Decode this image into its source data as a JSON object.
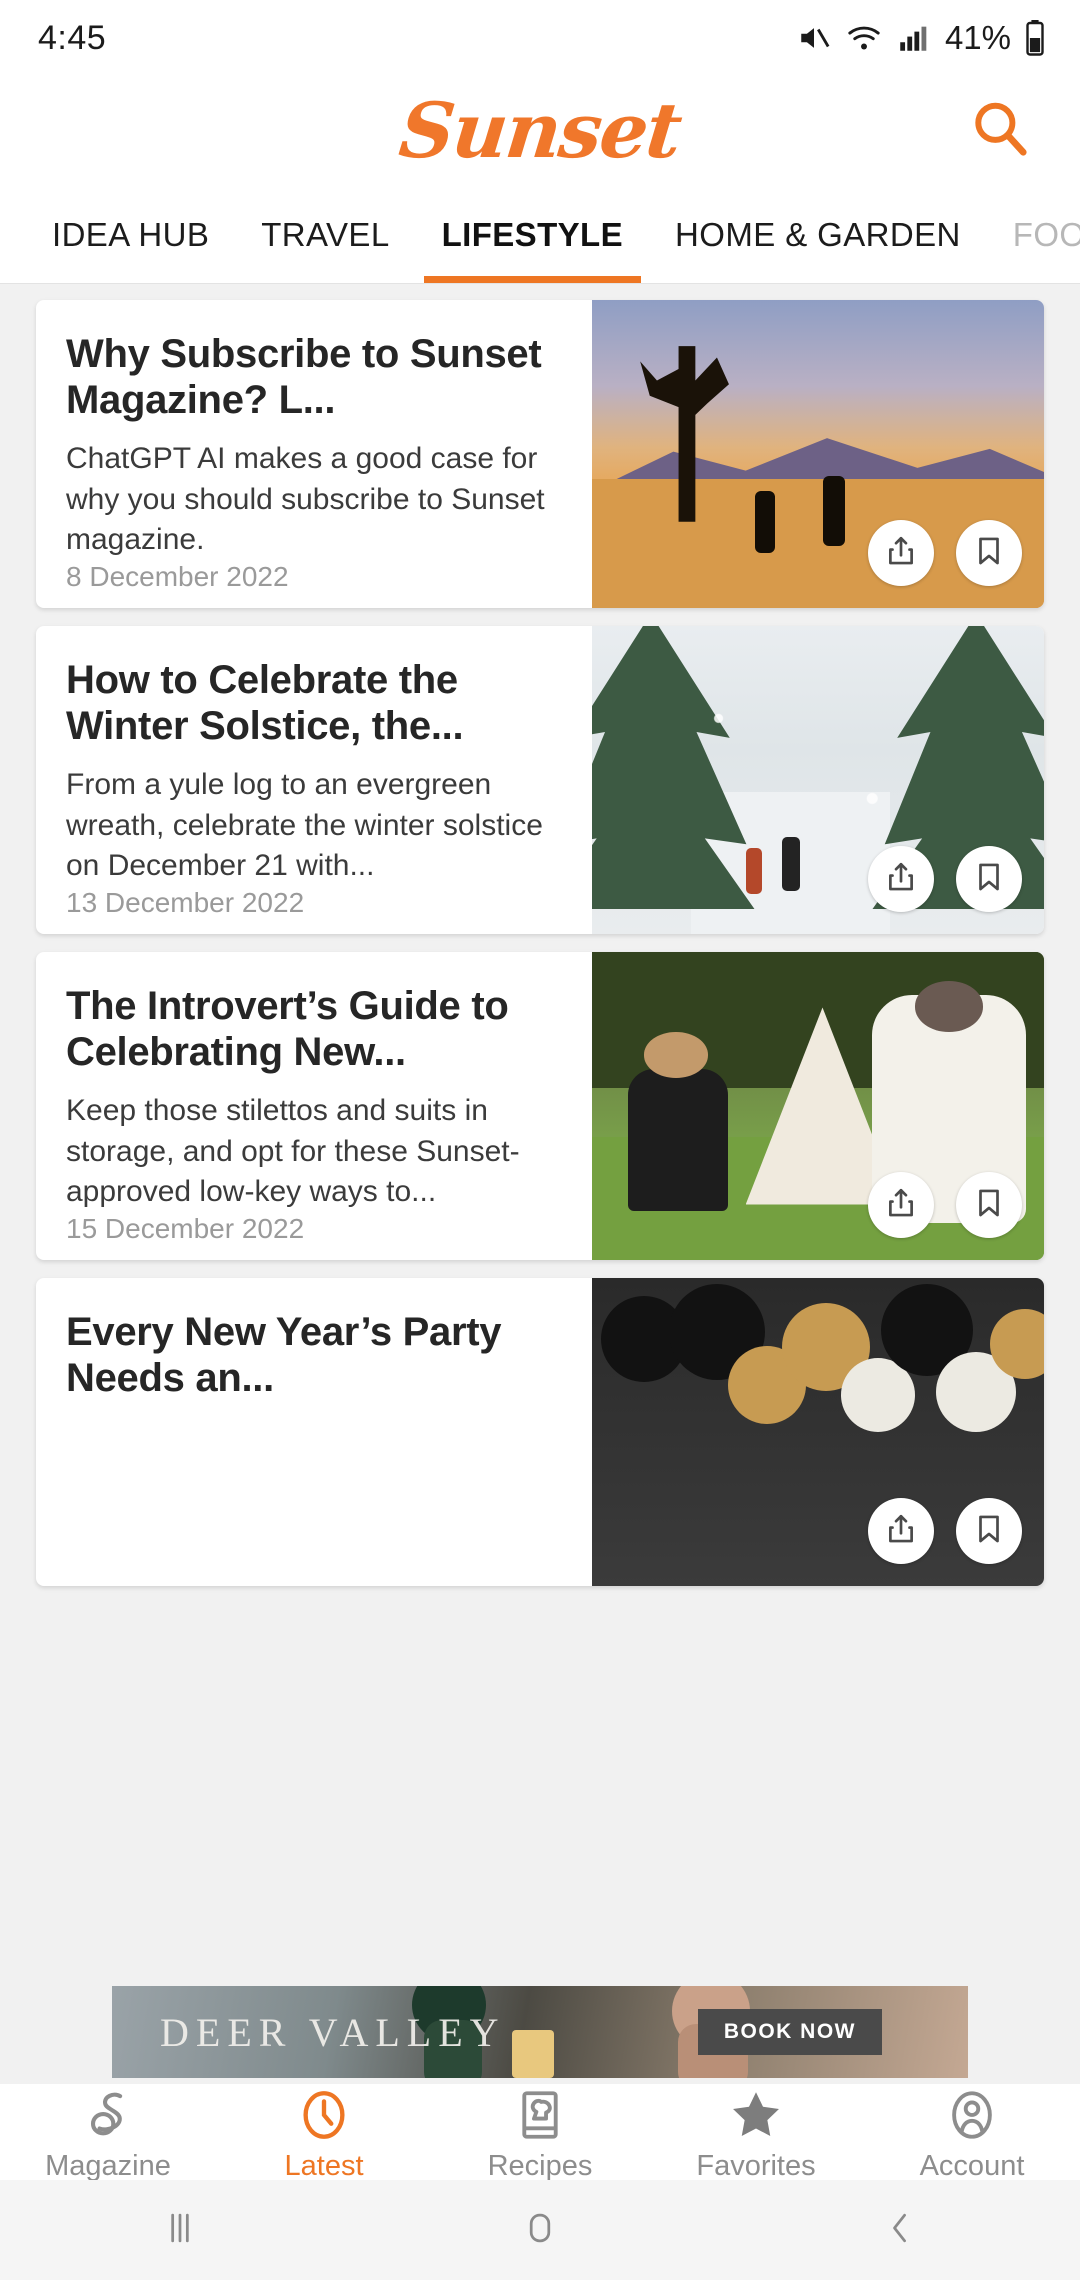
{
  "status_bar": {
    "time": "4:45",
    "battery_percent": "41%",
    "icons": [
      "mute-icon",
      "wifi-icon",
      "signal-icon",
      "battery-icon"
    ]
  },
  "header": {
    "logo_text": "Sunset",
    "search_icon": "search-icon",
    "brand_color": "#ee7623"
  },
  "category_tabs": [
    {
      "label": "IDEA HUB",
      "active": false
    },
    {
      "label": "TRAVEL",
      "active": false
    },
    {
      "label": "LIFESTYLE",
      "active": true
    },
    {
      "label": "HOME & GARDEN",
      "active": false
    },
    {
      "label": "FOOD",
      "active": false,
      "clipped": true
    }
  ],
  "feed": {
    "articles": [
      {
        "title": "Why Subscribe to Sunset Magazine? L...",
        "description": "ChatGPT AI makes a good case for why you should subscribe to Sunset magazine.",
        "date": "8 December 2022",
        "image_alt": "joshua-tree-desert-sunset-photo",
        "share_icon": "share-icon",
        "bookmark_icon": "bookmark-icon"
      },
      {
        "title": "How to Celebrate the Winter Solstice, the...",
        "description": "From a yule log to an evergreen wreath, celebrate the winter solstice on December 21 with...",
        "date": "13 December 2022",
        "image_alt": "snowy-evergreen-forest-path-photo",
        "share_icon": "share-icon",
        "bookmark_icon": "bookmark-icon"
      },
      {
        "title": "The Introvert’s Guide to Celebrating New...",
        "description": "Keep those stilettos and suits in storage, and opt for these Sunset-approved low-key ways to...",
        "date": "15 December 2022",
        "image_alt": "backyard-tent-gathering-photo",
        "share_icon": "share-icon",
        "bookmark_icon": "bookmark-icon"
      },
      {
        "title": "Every New Year’s Party Needs an...",
        "description": "",
        "date": "",
        "image_alt": "black-gold-white-balloon-arch-photo",
        "share_icon": "share-icon",
        "bookmark_icon": "bookmark-icon"
      }
    ]
  },
  "ad_banner": {
    "brand": "DEER VALLEY",
    "cta_label": "BOOK NOW"
  },
  "bottom_nav": [
    {
      "label": "Magazine",
      "icon": "sunset-s-logo-icon",
      "active": false
    },
    {
      "label": "Latest",
      "icon": "clock-icon",
      "active": true
    },
    {
      "label": "Recipes",
      "icon": "recipe-book-icon",
      "active": false
    },
    {
      "label": "Favorites",
      "icon": "star-icon",
      "active": false
    },
    {
      "label": "Account",
      "icon": "person-icon",
      "active": false
    }
  ],
  "system_nav": [
    {
      "icon": "recents-icon"
    },
    {
      "icon": "home-icon"
    },
    {
      "icon": "back-icon"
    }
  ]
}
